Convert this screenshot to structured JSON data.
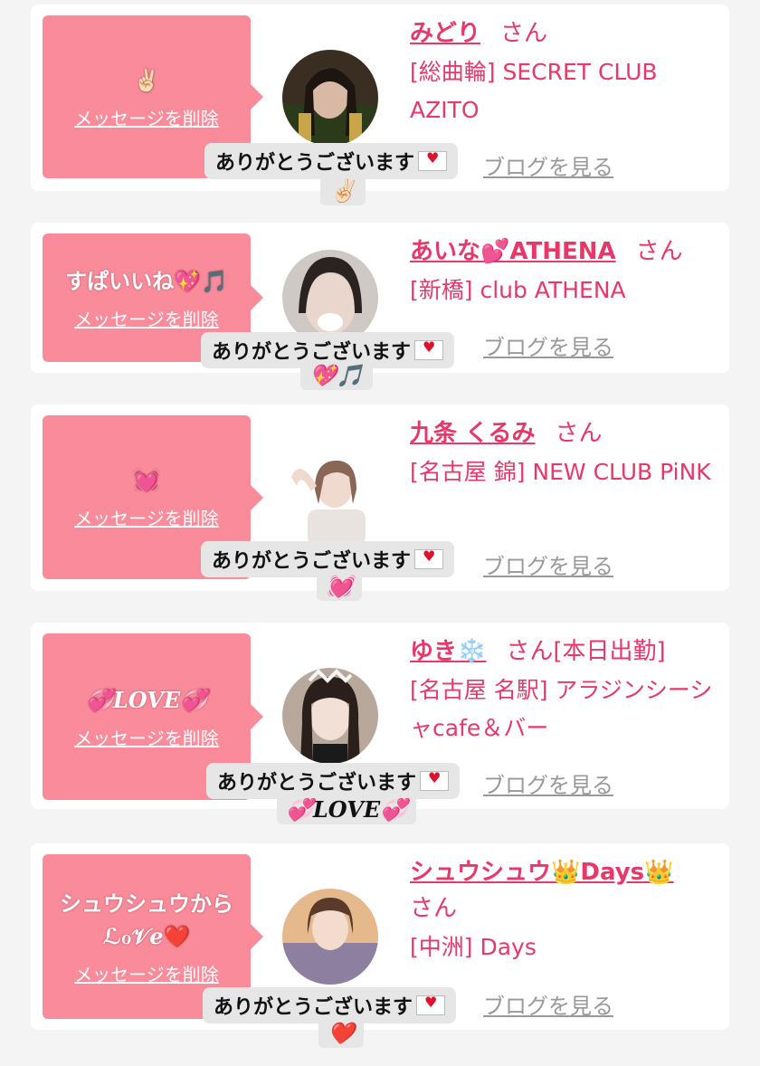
{
  "common": {
    "delete_label": "メッセージを削除",
    "san_label": "さん",
    "blog_label": "ブログを見る",
    "thanks_label": "ありがとうございます",
    "envelope_icon": "love-letter-icon"
  },
  "cards": [
    {
      "message": "✌🏻",
      "name": "みどり",
      "san": "さん",
      "shop": "[総曲輪] SECRET CLUB AZITO",
      "reaction": "✌🏻"
    },
    {
      "message": "すぱいいね💖🎵",
      "name": "あいな💕ATHENA",
      "san": "さん",
      "shop": "[新橋] club ATHENA",
      "reaction": "💖🎵"
    },
    {
      "message": "💓",
      "name": "九条 くるみ",
      "san": "さん",
      "shop": "[名古屋 錦] NEW CLUB PiNK",
      "reaction": "💓"
    },
    {
      "message": "💞LOVE💞",
      "name": "ゆき❄️",
      "san": "さん[本日出勤]",
      "shop": "[名古屋 名駅] アラジンシーシャcafe＆バー",
      "reaction": "💞LOVE💞"
    },
    {
      "message": "シュウシュウから ℒℴ𝒱ℯ❤️",
      "name": "シュウシュウ👑Days👑",
      "san": "さん",
      "shop": "[中洲] Days",
      "reaction": "❤️"
    }
  ]
}
